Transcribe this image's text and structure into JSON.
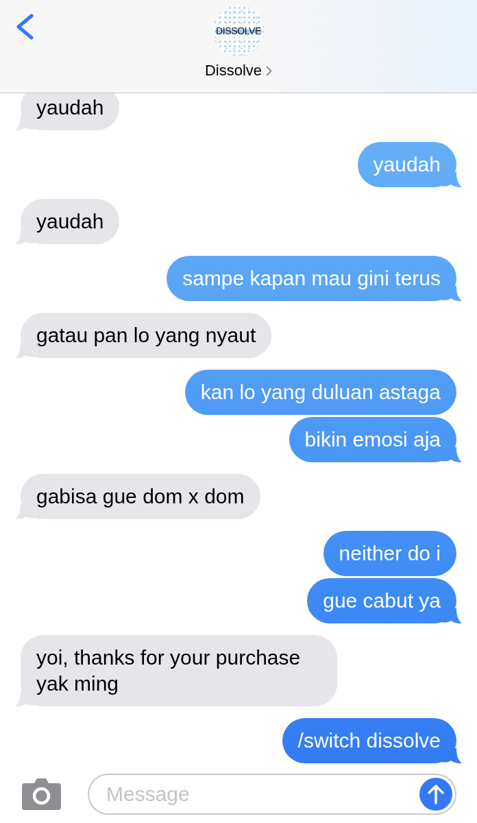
{
  "header": {
    "avatar": {
      "logo_text": "DISSOLVE"
    },
    "contact_name": "Dissolve"
  },
  "messages": [
    {
      "kind": "received",
      "text": "yaudah"
    },
    {
      "kind": "sent",
      "text": "yaudah"
    },
    {
      "kind": "received",
      "text": "yaudah"
    },
    {
      "kind": "sent",
      "text": "sampe kapan mau gini terus"
    },
    {
      "kind": "received",
      "text": "gatau pan lo yang nyaut"
    },
    {
      "kind": "sent",
      "text": "kan lo yang duluan astaga"
    },
    {
      "kind": "sent",
      "text": "bikin emosi aja"
    },
    {
      "kind": "received",
      "text": "gabisa gue dom x dom"
    },
    {
      "kind": "sent",
      "text": "neither do i"
    },
    {
      "kind": "sent",
      "text": "gue cabut ya"
    },
    {
      "kind": "received",
      "text": "yoi, thanks for your purchase yak ming"
    },
    {
      "kind": "sent",
      "text": "/switch dissolve"
    }
  ],
  "composer": {
    "placeholder": "Message"
  }
}
